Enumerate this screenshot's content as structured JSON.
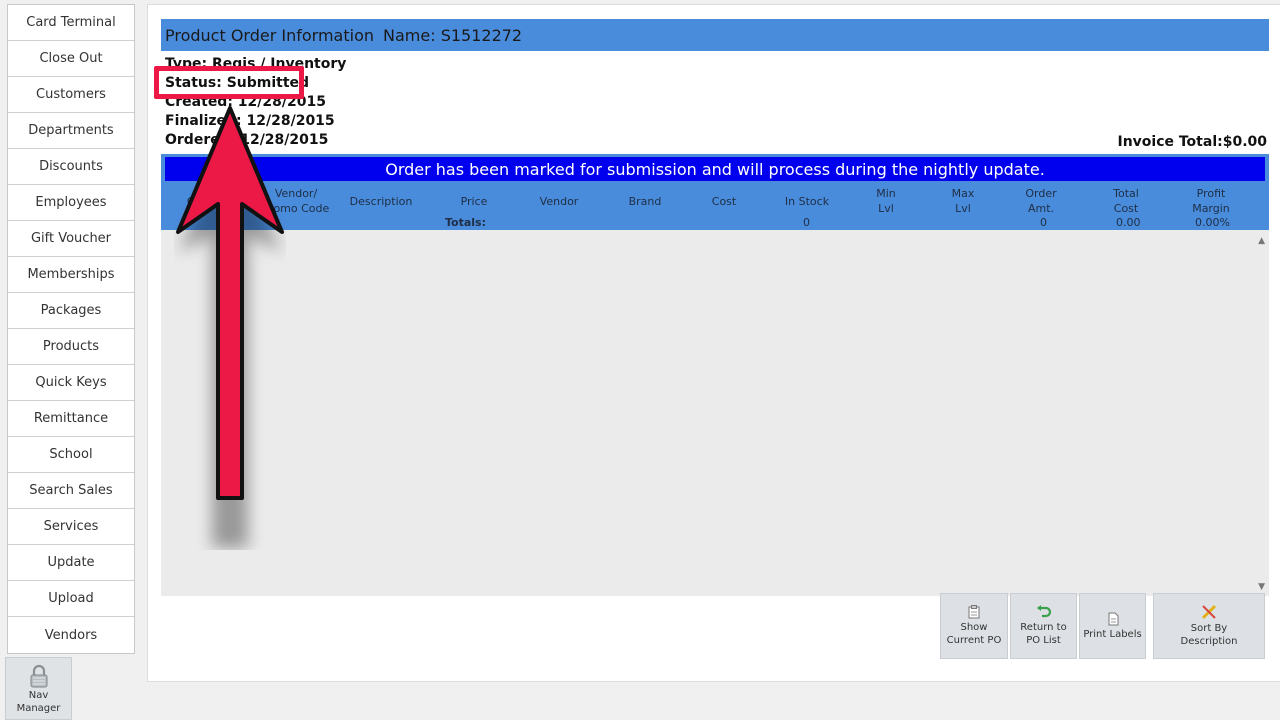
{
  "sidebar": {
    "items": [
      {
        "label": "Card Terminal"
      },
      {
        "label": "Close Out"
      },
      {
        "label": "Customers"
      },
      {
        "label": "Departments"
      },
      {
        "label": "Discounts"
      },
      {
        "label": "Employees"
      },
      {
        "label": "Gift Voucher"
      },
      {
        "label": "Memberships"
      },
      {
        "label": "Packages"
      },
      {
        "label": "Products"
      },
      {
        "label": "Quick Keys"
      },
      {
        "label": "Remittance"
      },
      {
        "label": "School"
      },
      {
        "label": "Search Sales"
      },
      {
        "label": "Services"
      },
      {
        "label": "Update"
      },
      {
        "label": "Upload"
      },
      {
        "label": "Vendors"
      }
    ],
    "nav_manager": {
      "line1": "Nav",
      "line2": "Manager",
      "icon": "lock-icon"
    }
  },
  "header": {
    "title": "Product Order Information",
    "name": "Name: S1512272"
  },
  "order": {
    "type": "Type:  Regis / Inventory",
    "status": "Status: Submitted",
    "created": "Created: 12/28/2015",
    "finalized": "Finalized: 12/28/2015",
    "ordered": "Ordered: 12/28/2015",
    "invoice_total": "Invoice Total:$0.00"
  },
  "banner": "Order has been marked for submission and will process during the nightly update.",
  "grid": {
    "columns": [
      {
        "line1": "Code",
        "line2": ""
      },
      {
        "line1": "Vendor/",
        "line2": "Promo Code"
      },
      {
        "line1": "Description",
        "line2": ""
      },
      {
        "line1": "Price",
        "line2": ""
      },
      {
        "line1": "Vendor",
        "line2": ""
      },
      {
        "line1": "Brand",
        "line2": ""
      },
      {
        "line1": "Cost",
        "line2": ""
      },
      {
        "line1": "In Stock",
        "line2": ""
      },
      {
        "line1": "Min",
        "line2": "Lvl"
      },
      {
        "line1": "Max",
        "line2": "Lvl"
      },
      {
        "line1": "Order",
        "line2": "Amt."
      },
      {
        "line1": "Total",
        "line2": "Cost"
      },
      {
        "line1": "Profit",
        "line2": "Margin"
      }
    ],
    "totals": {
      "label": "Totals:",
      "in_stock": "0",
      "order_amt": "0",
      "total_cost": "0.00",
      "profit_margin": "0.00%"
    }
  },
  "buttons": {
    "show_po": {
      "line1": "Show",
      "line2": "Current PO",
      "icon": "clipboard-icon"
    },
    "return_po": {
      "line1": "Return to",
      "line2": "PO List",
      "icon": "return-icon"
    },
    "print_labels": {
      "label": "Print Labels",
      "icon": "document-icon"
    },
    "sort_desc": {
      "line1": "Sort By",
      "line2": "Description",
      "icon": "pencil-icon"
    }
  },
  "colors": {
    "accent_blue": "#4a8cdc",
    "banner_blue": "#0000ee",
    "highlight_red": "#ec1846"
  }
}
